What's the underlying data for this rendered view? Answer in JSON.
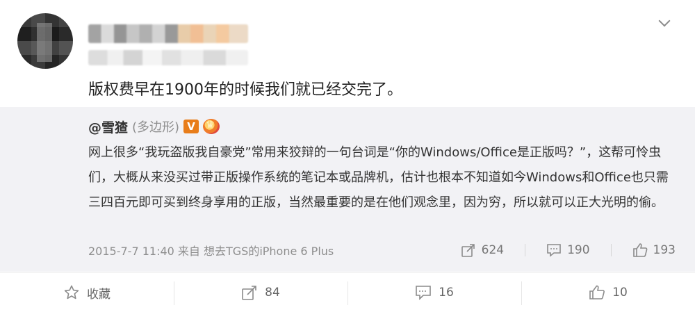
{
  "post": {
    "text": "版权费早在1900年的时候我们就已经交完了。"
  },
  "quote": {
    "author": "@雪猹",
    "tag": "(多边形)",
    "badge_v": "V",
    "text": "网上很多“我玩盗版我自豪党”常用来狡辩的一句台词是“你的Windows/Office是正版吗？”，这帮可怜虫们，大概从来没买过带正版操作系统的笔记本或品牌机，估计也根本不知道如今Windows和Office也只需三四百元即可买到终身享用的正版，当然最重要的是在他们观念里，因为穷，所以就可以正大光明的偷。",
    "meta": "2015-7-7 11:40  来自 想去TGS的iPhone 6 Plus",
    "stats": {
      "repost": "624",
      "comment": "190",
      "like": "193"
    }
  },
  "actions": {
    "favorite": "收藏",
    "repost": "84",
    "comment": "16",
    "like": "10"
  },
  "icons": {
    "more": "chevron-down-icon",
    "repost": "share-arrow-icon",
    "comment": "comment-bubble-icon",
    "like": "thumbs-up-icon",
    "favorite": "star-icon"
  },
  "colors": {
    "quote_bg": "#f2f2f5",
    "badge_v": "#e87d1a",
    "text": "#333333",
    "muted": "#8e8e8e"
  }
}
